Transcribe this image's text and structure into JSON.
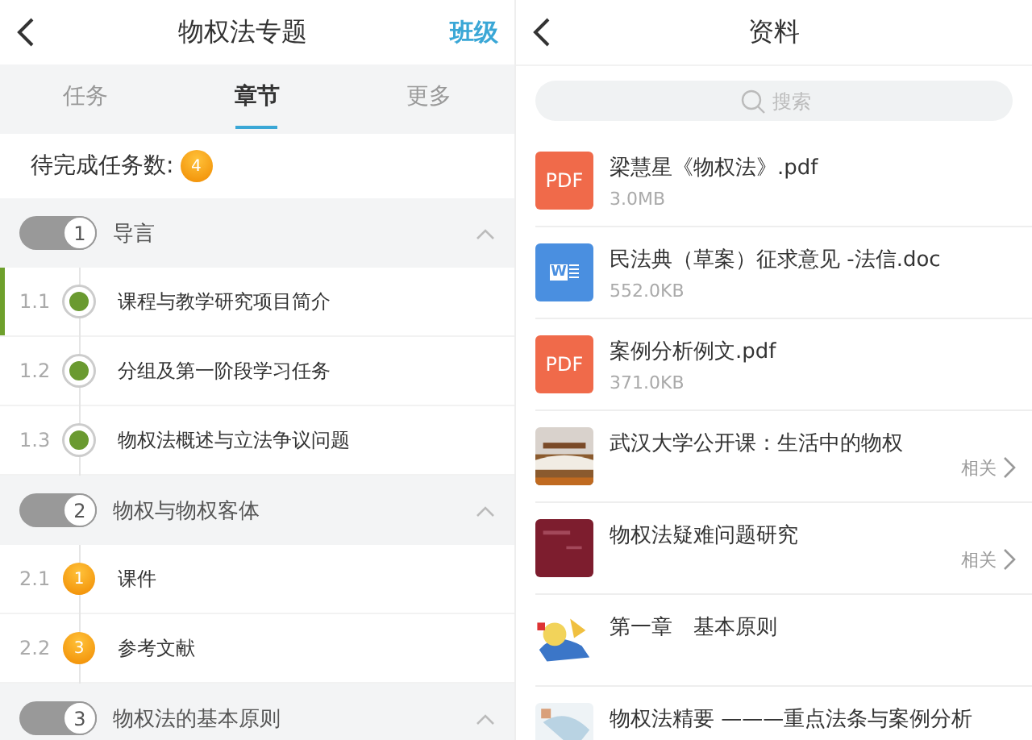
{
  "left": {
    "title": "物权法专题",
    "action": "班级",
    "tabs": [
      {
        "label": "任务",
        "selected": false
      },
      {
        "label": "章节",
        "selected": true
      },
      {
        "label": "更多",
        "selected": false
      }
    ],
    "pending": {
      "label": "待完成任务数:",
      "count": "4"
    },
    "chapters": [
      {
        "number": "1",
        "title": "导言",
        "expanded": true,
        "sections": [
          {
            "number": "1.1",
            "title": "课程与教学研究项目简介",
            "selected": true,
            "kind": "done"
          },
          {
            "number": "1.2",
            "title": "分组及第一阶段学习任务",
            "selected": false,
            "kind": "done"
          },
          {
            "number": "1.3",
            "title": "物权法概述与立法争议问题",
            "selected": false,
            "kind": "done"
          }
        ]
      },
      {
        "number": "2",
        "title": "物权与物权客体",
        "expanded": true,
        "sections": [
          {
            "number": "2.1",
            "title": "课件",
            "selected": false,
            "kind": "count",
            "count": "1"
          },
          {
            "number": "2.2",
            "title": "参考文献",
            "selected": false,
            "kind": "count",
            "count": "3"
          }
        ]
      },
      {
        "number": "3",
        "title": "物权法的基本原则",
        "expanded": true
      }
    ]
  },
  "right": {
    "title": "资料",
    "search": {
      "placeholder": "搜索"
    },
    "files": [
      {
        "kind": "pdf",
        "badge": "PDF",
        "name": "梁慧星《物权法》.pdf",
        "size": "3.0MB"
      },
      {
        "kind": "doc",
        "badge": "W",
        "name": "民法典（草案）征求意见 -法信.doc",
        "size": "552.0KB"
      },
      {
        "kind": "pdf",
        "badge": "PDF",
        "name": "案例分析例文.pdf",
        "size": "371.0KB"
      },
      {
        "kind": "picture",
        "name": "武汉大学公开课：生活中的物权",
        "related": "相关"
      },
      {
        "kind": "picture",
        "name": "物权法疑难问题研究",
        "related": "相关"
      },
      {
        "kind": "picture",
        "name": "第一章　基本原则"
      },
      {
        "kind": "picture",
        "name": "物权法精要 ———重点法条与案例分析"
      }
    ]
  }
}
